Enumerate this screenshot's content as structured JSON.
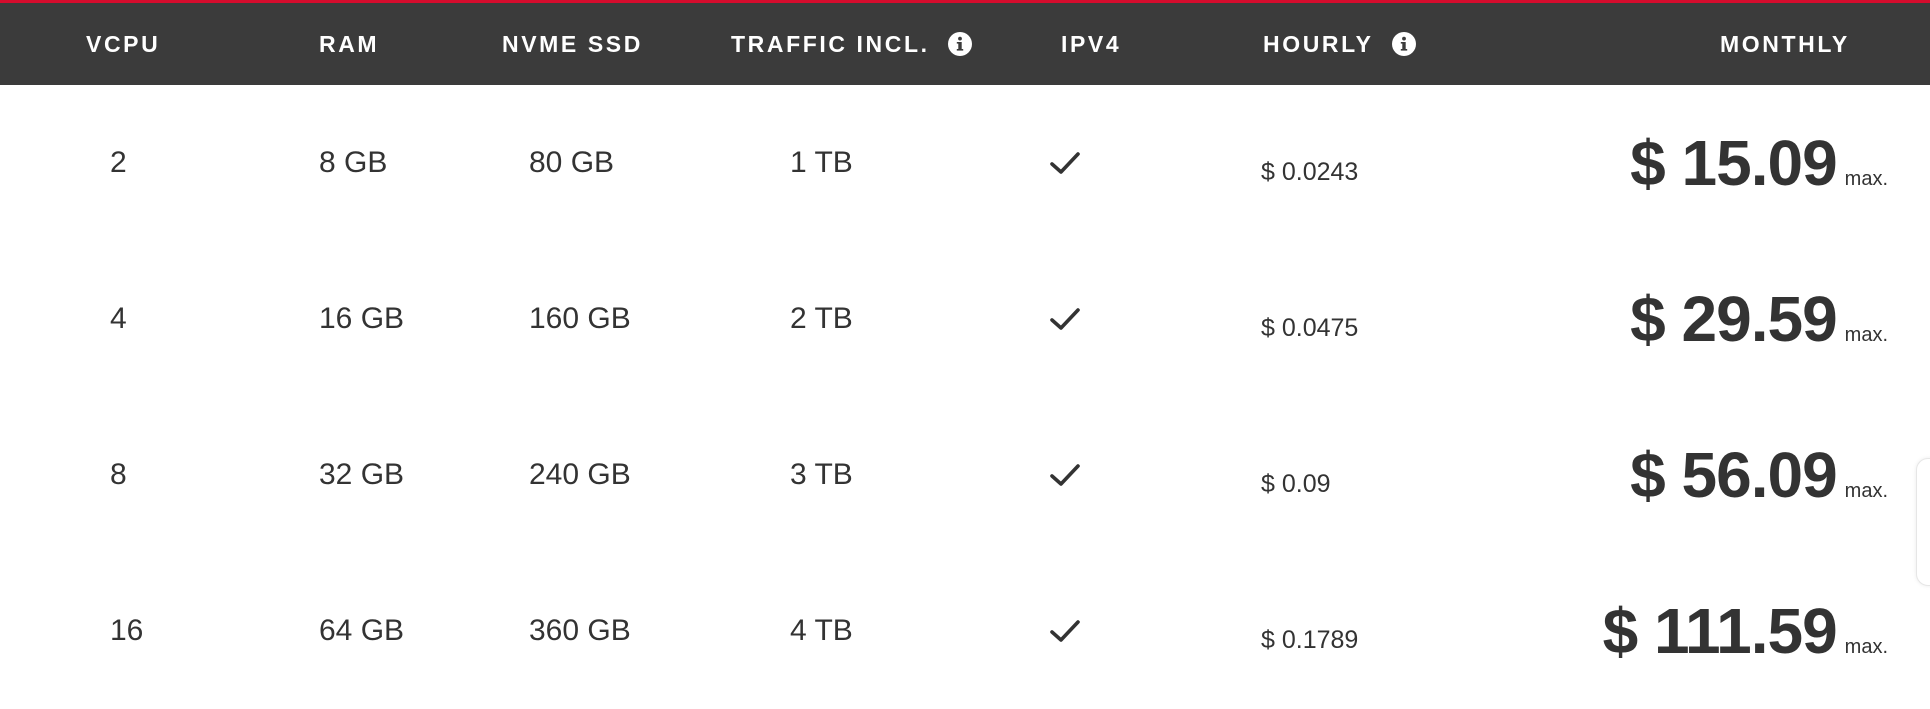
{
  "colors": {
    "accent": "#d50c2d",
    "header_bg": "#3b3b3b",
    "header_text": "#ffffff",
    "body_text": "#333333"
  },
  "header": {
    "vcpu": "VCPU",
    "ram": "RAM",
    "nvme_ssd": "NVME SSD",
    "traffic": "TRAFFIC INCL.",
    "ipv4": "IPV4",
    "hourly": "HOURLY",
    "monthly": "MONTHLY",
    "info_icon": "info-icon"
  },
  "rows": [
    {
      "vcpu": "2",
      "ram": "8 GB",
      "ssd": "80 GB",
      "traffic": "1 TB",
      "ipv4": "check-icon",
      "hourly": "$ 0.0243",
      "monthly": "$ 15.09",
      "max": "max."
    },
    {
      "vcpu": "4",
      "ram": "16 GB",
      "ssd": "160 GB",
      "traffic": "2 TB",
      "ipv4": "check-icon",
      "hourly": "$ 0.0475",
      "monthly": "$ 29.59",
      "max": "max."
    },
    {
      "vcpu": "8",
      "ram": "32 GB",
      "ssd": "240 GB",
      "traffic": "3 TB",
      "ipv4": "check-icon",
      "hourly": "$ 0.09",
      "monthly": "$ 56.09",
      "max": "max."
    },
    {
      "vcpu": "16",
      "ram": "64 GB",
      "ssd": "360 GB",
      "traffic": "4 TB",
      "ipv4": "check-icon",
      "hourly": "$ 0.1789",
      "monthly": "$ 111.59",
      "max": "max."
    }
  ]
}
